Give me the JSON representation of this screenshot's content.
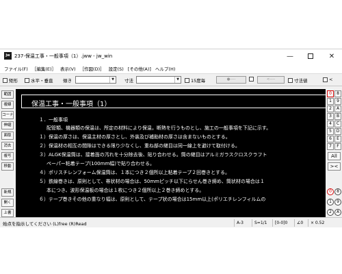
{
  "window": {
    "app_icon_text": "jw",
    "title": "237-保温工事・一般事項（1）.jww - jw_win",
    "minimize_label": "—",
    "close_label": "✕"
  },
  "menu": [
    "ファイル(F)",
    "［編集(E)］",
    "表示(V)",
    "［作図(D)］",
    "設定(S)",
    "[その他(A)]",
    "ヘルプ(H)"
  ],
  "toolbar": {
    "rect": "矩形",
    "hv": "水平・垂直",
    "slope": "傾き",
    "dimension": "寸法",
    "fifteen_deg": "15度毎",
    "btn1": "●----",
    "btn2": "<----",
    "dim_value": "寸法値",
    "lt": "<"
  },
  "left_palette": [
    "範囲",
    "複線",
    "コーナー",
    "伸縮",
    "面取",
    "消去",
    "複写",
    "移動",
    "新規",
    "開く",
    "上書"
  ],
  "document": {
    "title": "保温工事・一般事項（1）",
    "lines": [
      "１．一般事項",
      "配管類、機器類の保温は、所定の材料により保温，断熱を行うものとし、施工の一般事項を下記に示す。",
      "１）保温の厚さは、保温主材の厚さとし、外装及び補助材の厚さは含まないものとする。",
      "２）保温材の相互の間隙はできる限り少なくし、重ね部の継目は同一線上を避けて取付ける。",
      "３）ALGK保温筒は、接着面の汚れを十分除去後、貼り合わせる。筒の継目はアルミガラスクロスクラフト",
      "ペーパー粘着テープ(100mm幅)で貼り合わせる。",
      "４）ポリスチレンフォーム保温筒は、１本につき２個所以上粘着テープ２回巻きとする。",
      "５）鉄線巻きは、原則として、帯状材の場合は、50mmピッチ以下にらせん巻き締め、筒状材の場合は１",
      "本につき、波形保温板の場合は１枚につき２個所以上２巻き締めとする。",
      "６）テープ巻きその他の重なり幅は、原則として、テープ状の場合は15mm以上(ポリエチレンフィルムの"
    ]
  },
  "layers": {
    "numbers": [
      "0",
      "1",
      "2",
      "3",
      "4",
      "5",
      "6",
      "7"
    ],
    "letters": [
      "8",
      "9",
      "A",
      "B",
      "C",
      "D",
      "E",
      "F"
    ],
    "all": "All",
    "invert": "><",
    "circles": [
      "0",
      "8",
      "1",
      "9",
      "2",
      "A"
    ]
  },
  "status": {
    "message": "始点を指示してください (L)free (R)Read",
    "paper": "A-3",
    "scale": "S=1/1",
    "layer": "[0-0]0",
    "angle": "∠0",
    "zoom": "× 0.52"
  },
  "colors": {
    "canvas_bg": "#000000",
    "canvas_text": "#ffffff",
    "active_layer": "#d00000"
  }
}
